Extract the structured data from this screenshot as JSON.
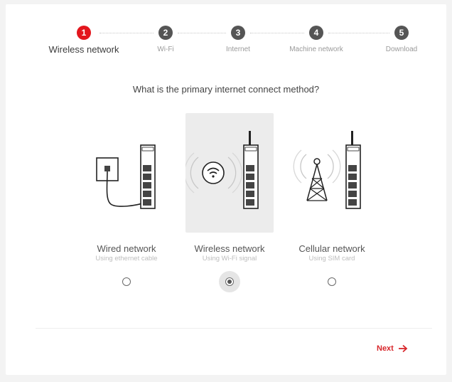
{
  "steps": [
    {
      "number": "1",
      "label": "Wireless network",
      "active": true
    },
    {
      "number": "2",
      "label": "Wi-Fi",
      "active": false
    },
    {
      "number": "3",
      "label": "Internet",
      "active": false
    },
    {
      "number": "4",
      "label": "Machine network",
      "active": false
    },
    {
      "number": "5",
      "label": "Download",
      "active": false
    }
  ],
  "question": "What is the primary internet connect method?",
  "options": [
    {
      "title": "Wired network",
      "subtitle": "Using ethernet cable",
      "selected": false,
      "icon": "wired-router-icon"
    },
    {
      "title": "Wireless network",
      "subtitle": "Using Wi-Fi signal",
      "selected": true,
      "icon": "wifi-router-icon"
    },
    {
      "title": "Cellular network",
      "subtitle": "Using SIM card",
      "selected": false,
      "icon": "cellular-router-icon"
    }
  ],
  "footer": {
    "next_label": "Next",
    "next_icon": "arrow-right-icon"
  },
  "colors": {
    "accent": "#e3161d",
    "step_inactive": "#555555"
  }
}
